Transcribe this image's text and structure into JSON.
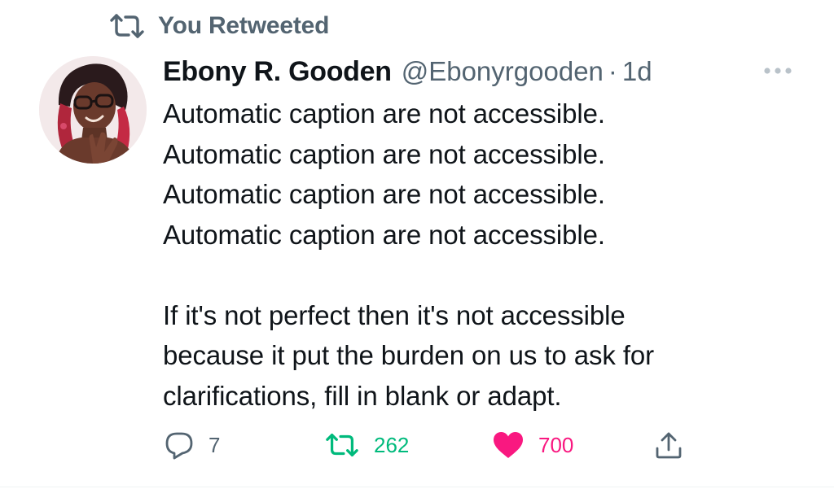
{
  "social_context": {
    "icon": "retweet-icon",
    "label": "You Retweeted"
  },
  "author": {
    "display_name": "Ebony R. Gooden",
    "handle": "@Ebonyrgooden",
    "separator": "·",
    "timestamp": "1d",
    "avatar_icon": "avatar-photo"
  },
  "menu": {
    "icon": "more-icon"
  },
  "tweet": {
    "lines": [
      "Automatic caption are not accessible.",
      "Automatic caption are not accessible.",
      "Automatic caption are not accessible.",
      "Automatic caption are not accessible.",
      "",
      "If it's not perfect then it's not accessible",
      "because it put the burden on us to ask for",
      "clarifications, fill in blank or adapt."
    ]
  },
  "actions": {
    "reply": {
      "icon": "reply-icon",
      "count": "7"
    },
    "retweet": {
      "icon": "retweet-icon",
      "count": "262",
      "active": true,
      "color": "#00ba7c"
    },
    "like": {
      "icon": "heart-icon",
      "count": "700",
      "active": true,
      "color": "#f91880"
    },
    "share": {
      "icon": "share-icon"
    }
  },
  "colors": {
    "secondary_text": "#536471",
    "primary_text": "#0f1419",
    "retweet_green": "#00ba7c",
    "like_pink": "#f91880"
  }
}
